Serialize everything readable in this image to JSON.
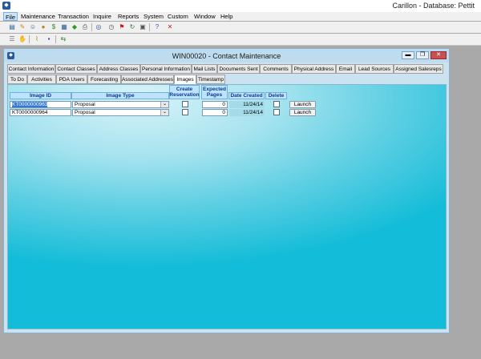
{
  "app": {
    "title": "Carillon - Database: Pettit",
    "icon": "app-logo-icon"
  },
  "menu": [
    "File",
    "Maintenance",
    "Transaction",
    "Inquire",
    "Reports",
    "System",
    "Custom",
    "Window",
    "Help"
  ],
  "toolbar": {
    "row1": [
      "new-document-icon",
      "edit-document-icon",
      "person-icon",
      "money-bag-icon",
      "dollar-icon",
      "notebook-icon",
      "green-arrow-icon",
      "printer-icon",
      "search-icon",
      "clock-icon",
      "red-flag-icon",
      "refresh-icon",
      "form-icon",
      "help-icon",
      "close-window-icon"
    ],
    "row2": [
      "list-icon",
      "hand-icon",
      "broom-icon",
      "save-icon",
      "switch-icon"
    ]
  },
  "window": {
    "title": "WIN00020 - Contact Maintenance",
    "minimize": "▬",
    "restore": "❐",
    "close": "✕"
  },
  "tabs": {
    "row1": [
      "Contact Information",
      "Contact Classes",
      "Address Classes",
      "Personal Information",
      "Mail Lists",
      "Documents Sent",
      "Comments",
      "Physical Address",
      "Email",
      "Lead Sources",
      "Assigned Salesreps"
    ],
    "row2": [
      "To Do",
      "Activities",
      "PDA Users",
      "Forecasting",
      "Associated Addresses",
      "Images",
      "Timestamp"
    ],
    "active": "Images"
  },
  "grid": {
    "headers": {
      "image_id": "Image ID",
      "image_type": "Image Type",
      "create_reservation": "Create\nReservation",
      "expected_pages": "Expected\nPages",
      "date_created": "Date Created",
      "delete": "Delete"
    },
    "rows": [
      {
        "image_id": "KT0000000963",
        "image_type": "Proposal",
        "create_reservation": false,
        "expected_pages": "0",
        "date_created": "11/24/14",
        "delete": false,
        "action": "Launch"
      },
      {
        "image_id": "KT0000000964",
        "image_type": "Proposal",
        "create_reservation": false,
        "expected_pages": "0",
        "date_created": "11/24/14",
        "delete": false,
        "action": "Launch"
      }
    ]
  }
}
